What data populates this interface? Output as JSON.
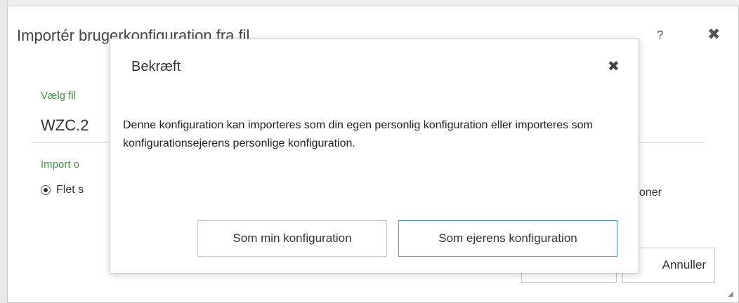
{
  "outer_dialog": {
    "title": "Importér brugerkonfiguration fra fil",
    "help_label": "?",
    "close_label": "✖",
    "file_label": "Vælg fil",
    "file_value": "WZC.2",
    "import_label": "Import o",
    "radio_label": "Flet s",
    "behind_text": "ationer",
    "button_1_label": "",
    "button_2_label": "Annuller"
  },
  "modal": {
    "title": "Bekræft",
    "close_label": "✖",
    "message": "Denne konfiguration kan importeres som din egen personlig konfiguration eller importeres som konfigurationsejerens personlige konfiguration.",
    "primary_button": "Som min konfiguration",
    "secondary_button": "Som ejerens konfiguration"
  },
  "colors": {
    "label_green": "#3a9a3a",
    "focus_blue": "#41a0d8"
  }
}
